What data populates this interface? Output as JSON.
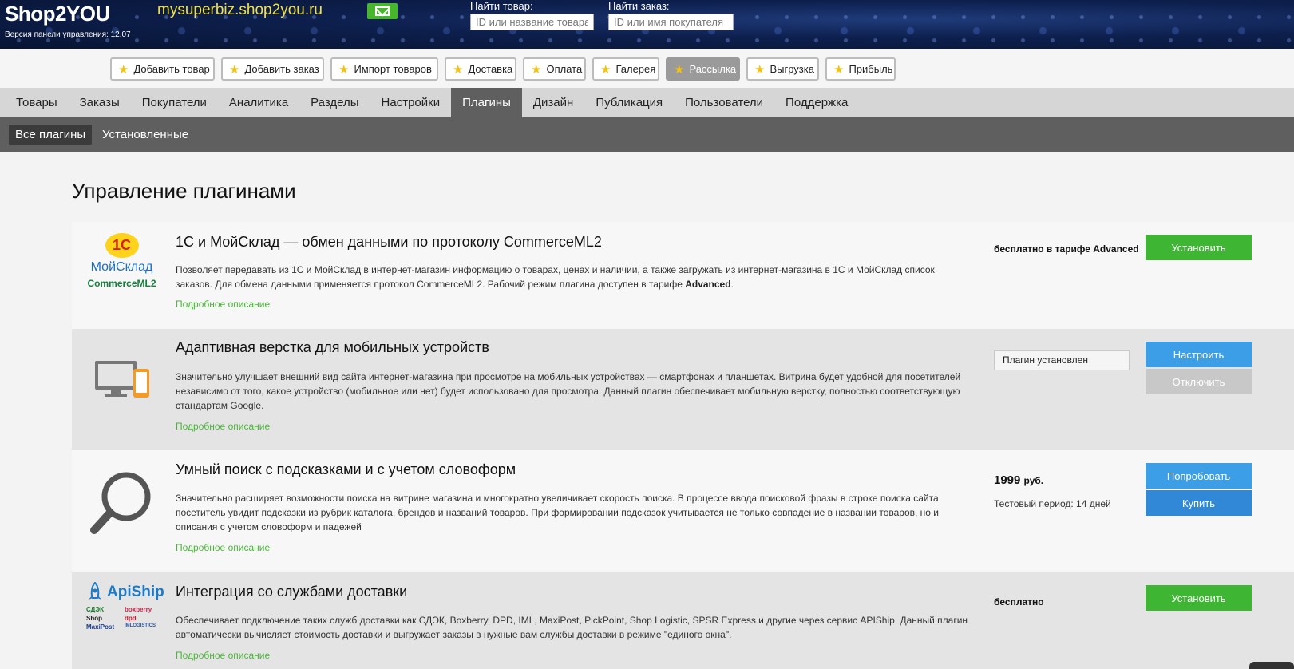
{
  "header": {
    "logo": "Shop2YOU",
    "version": "Версия панели управления: 12.07",
    "domain": "mysuperbiz.shop2you.ru",
    "search_product_label": "Найти товар:",
    "search_product_placeholder": "ID или название товара",
    "search_order_label": "Найти заказ:",
    "search_order_placeholder": "ID или имя покупателя"
  },
  "quick_buttons": [
    {
      "label": "Добавить товар"
    },
    {
      "label": "Добавить заказ"
    },
    {
      "label": "Импорт товаров"
    },
    {
      "label": "Доставка"
    },
    {
      "label": "Оплата"
    },
    {
      "label": "Галерея"
    },
    {
      "label": "Рассылка",
      "active": true
    },
    {
      "label": "Выгрузка"
    },
    {
      "label": "Прибыль"
    }
  ],
  "main_nav": [
    {
      "label": "Товары"
    },
    {
      "label": "Заказы"
    },
    {
      "label": "Покупатели"
    },
    {
      "label": "Аналитика"
    },
    {
      "label": "Разделы"
    },
    {
      "label": "Настройки"
    },
    {
      "label": "Плагины",
      "active": true
    },
    {
      "label": "Дизайн"
    },
    {
      "label": "Публикация"
    },
    {
      "label": "Пользователи"
    },
    {
      "label": "Поддержка"
    }
  ],
  "sub_nav": [
    {
      "label": "Все плагины",
      "active": true
    },
    {
      "label": "Установленные"
    }
  ],
  "page_title": "Управление плагинами",
  "plugins": [
    {
      "title": "1С и МойСклад — обмен данными по протоколу CommerceML2",
      "desc_main": "Позволяет передавать из 1С и МойСклад в интернет-магазин информацию о товарах, ценах и наличии, а также загружать из интернет-магазина в 1С и МойСклад список заказов. Для обмена данными применяется протокол CommerceML2. Рабочий режим плагина доступен в тарифе ",
      "desc_bold": "Advanced",
      "desc_end": ".",
      "link": "Подробное описание",
      "status": "бесплатно в тарифе Advanced",
      "button": "Установить",
      "logo": {
        "top": "1С",
        "middle": "МойСклад",
        "bottom": "CommerceML2"
      }
    },
    {
      "title": "Адаптивная верстка для мобильных устройств",
      "desc": "Значительно улучшает внешний вид сайта интернет-магазина при просмотре на мобильных устройствах — смартфонах и планшетах. Витрина будет удобной для посетителей независимо от того, какое устройство (мобильное или нет) будет использовано для просмотра. Данный плагин обеспечивает мобильную верстку, полностью соответствующую стандартам Google.",
      "link": "Подробное описание",
      "status": "Плагин установлен",
      "button_primary": "Настроить",
      "button_secondary": "Отключить",
      "icon": "devices-icon"
    },
    {
      "title": "Умный поиск с подсказками и с учетом словоформ",
      "desc": "Значительно расширяет возможности поиска на витрине магазина и многократно увеличивает скорость поиска. В процессе ввода поисковой фразы в строке поиска сайта посетитель увидит подсказки из рубрик каталога, брендов и названий товаров. При формировании подсказок учитывается не только совпадение в названии товаров, но и описания с учетом словоформ и падежей",
      "link": "Подробное описание",
      "price": "1999",
      "currency": "руб.",
      "trial": "Тестовый период: 14 дней",
      "button_primary": "Попробовать",
      "button_secondary": "Купить",
      "icon": "magnifier-icon"
    },
    {
      "title": "Интеграция со службами доставки",
      "desc": "Обеспечивает подключение таких служб доставки как СДЭК, Boxberry, DPD, IML, MaxiPost, PickPoint, Shop Logistic, SPSR Express и другие через сервис APIShip. Данный плагин автоматически вычисляет стоимость доставки и выгружает заказы в нужные вам службы доставки в режиме \"единого окна\".",
      "link": "Подробное описание",
      "status": "бесплатно",
      "button": "Установить",
      "logo": {
        "brand": "ApiShip",
        "partners": [
          "СДЭК",
          "boxberry",
          "Shop",
          "dpd",
          "MaxiPost",
          "IMLOGISTICS"
        ]
      }
    }
  ]
}
